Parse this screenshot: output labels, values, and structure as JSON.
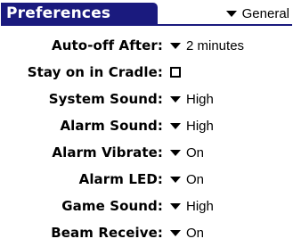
{
  "title": "Preferences",
  "category": {
    "selected": "General",
    "icon": "triangle-down-icon"
  },
  "rows": [
    {
      "label": "Auto-off After:",
      "control": "popup",
      "value": "2 minutes"
    },
    {
      "label": "Stay on in Cradle:",
      "control": "checkbox",
      "checked": false
    },
    {
      "label": "System Sound:",
      "control": "popup",
      "value": "High"
    },
    {
      "label": "Alarm Sound:",
      "control": "popup",
      "value": "High"
    },
    {
      "label": "Alarm Vibrate:",
      "control": "popup",
      "value": "On"
    },
    {
      "label": "Alarm LED:",
      "control": "popup",
      "value": "On"
    },
    {
      "label": "Game Sound:",
      "control": "popup",
      "value": "High"
    },
    {
      "label": "Beam Receive:",
      "control": "popup",
      "value": "On"
    }
  ],
  "colors": {
    "title_bar": "#1a1a7e",
    "title_text": "#ffffff",
    "background": "#ffffff",
    "text": "#000000"
  }
}
